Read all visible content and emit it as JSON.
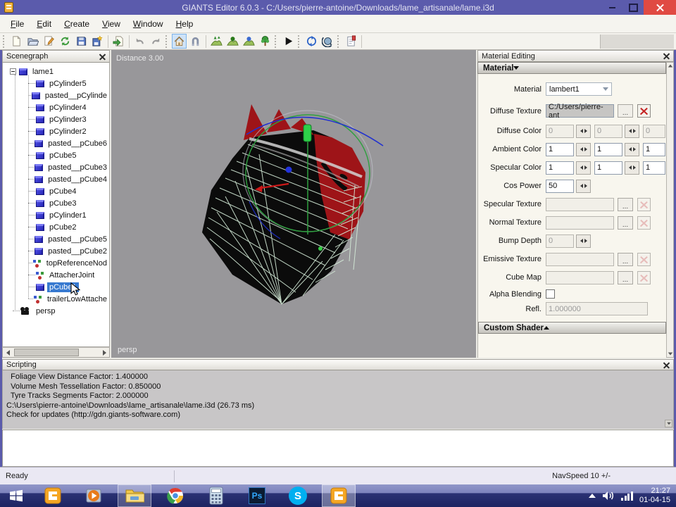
{
  "window": {
    "title": "GIANTS Editor 6.0.3 - C:/Users/pierre-antoine/Downloads/lame_artisanale/lame.i3d"
  },
  "menu": {
    "items": [
      {
        "label": "File"
      },
      {
        "label": "Edit"
      },
      {
        "label": "Create"
      },
      {
        "label": "View"
      },
      {
        "label": "Window"
      },
      {
        "label": "Help"
      }
    ]
  },
  "toolbar": {
    "icons": [
      "new-file",
      "open-file",
      "edit-script",
      "reload",
      "save",
      "export",
      "import",
      "undo",
      "redo",
      "move-home",
      "snap-magnet",
      "terrain-sculpt",
      "terrain-smooth",
      "terrain-paint",
      "foliage-paint",
      "play",
      "reload-shaders",
      "visualization",
      "show-log"
    ]
  },
  "scenegraph": {
    "title": "Scenegraph",
    "nodes": [
      {
        "label": "lame1",
        "type": "cube",
        "depth": 0,
        "expanded": true,
        "selected": false
      },
      {
        "label": "pCylinder5",
        "type": "cube",
        "depth": 1,
        "selected": false
      },
      {
        "label": "pasted__pCylinde",
        "type": "cube",
        "depth": 1,
        "selected": false
      },
      {
        "label": "pCylinder4",
        "type": "cube",
        "depth": 1,
        "selected": false
      },
      {
        "label": "pCylinder3",
        "type": "cube",
        "depth": 1,
        "selected": false
      },
      {
        "label": "pCylinder2",
        "type": "cube",
        "depth": 1,
        "selected": false
      },
      {
        "label": "pasted__pCube6",
        "type": "cube",
        "depth": 1,
        "selected": false
      },
      {
        "label": "pCube5",
        "type": "cube",
        "depth": 1,
        "selected": false
      },
      {
        "label": "pasted__pCube3",
        "type": "cube",
        "depth": 1,
        "selected": false
      },
      {
        "label": "pasted__pCube4",
        "type": "cube",
        "depth": 1,
        "selected": false
      },
      {
        "label": "pCube4",
        "type": "cube",
        "depth": 1,
        "selected": false
      },
      {
        "label": "pCube3",
        "type": "cube",
        "depth": 1,
        "selected": false
      },
      {
        "label": "pCylinder1",
        "type": "cube",
        "depth": 1,
        "selected": false
      },
      {
        "label": "pCube2",
        "type": "cube",
        "depth": 1,
        "selected": false
      },
      {
        "label": "pasted__pCube5",
        "type": "cube",
        "depth": 1,
        "selected": false
      },
      {
        "label": "pasted__pCube2",
        "type": "cube",
        "depth": 1,
        "selected": false
      },
      {
        "label": "topReferenceNod",
        "type": "group",
        "depth": 1,
        "selected": false
      },
      {
        "label": "AttacherJoint",
        "type": "group",
        "depth": 1,
        "selected": false
      },
      {
        "label": "pCube1",
        "type": "cube",
        "depth": 1,
        "selected": true
      },
      {
        "label": "trailerLowAttache",
        "type": "group",
        "depth": 1,
        "selected": false
      },
      {
        "label": "persp",
        "type": "camera",
        "depth": 0,
        "selected": false
      }
    ]
  },
  "viewport": {
    "distance_label": "Distance 3.00",
    "camera_label": "persp"
  },
  "material": {
    "panel_title": "Material Editing",
    "section_title": "Material",
    "material_label": "Material",
    "material_value": "lambert1",
    "diffuse_texture_label": "Diffuse Texture",
    "diffuse_texture_value": "C:/Users/pierre-ant",
    "browse_label": "...",
    "diffuse_color_label": "Diffuse Color",
    "diffuse_color": [
      "0",
      "0",
      "0"
    ],
    "ambient_color_label": "Ambient Color",
    "ambient_color": [
      "1",
      "1",
      "1"
    ],
    "specular_color_label": "Specular Color",
    "specular_color": [
      "1",
      "1",
      "1"
    ],
    "cos_power_label": "Cos Power",
    "cos_power_value": "50",
    "specular_texture_label": "Specular Texture",
    "normal_texture_label": "Normal Texture",
    "bump_depth_label": "Bump Depth",
    "bump_depth_value": "0",
    "emissive_texture_label": "Emissive Texture",
    "cube_map_label": "Cube Map",
    "alpha_blending_label": "Alpha Blending",
    "refl_label": "Refl.",
    "refl_value": "1.000000",
    "custom_shader_title": "Custom Shader"
  },
  "scripting": {
    "title": "Scripting",
    "lines": [
      "  Foliage View Distance Factor: 1.400000",
      "  Volume Mesh Tessellation Factor: 0.850000",
      "  Tyre Tracks Segments Factor: 2.000000",
      "C:\\Users\\pierre-antoine\\Downloads\\lame_artisanale\\lame.i3d (26.73 ms)",
      "Check for updates (http://gdn.giants-software.com)"
    ]
  },
  "statusbar": {
    "ready": "Ready",
    "navspeed": "NavSpeed 10 +/-"
  },
  "taskbar": {
    "apps": [
      "start",
      "giants-editor",
      "media-player",
      "file-explorer",
      "chrome",
      "calculator",
      "photoshop",
      "skype",
      "giants-editor-active"
    ],
    "photoshop_label": "Ps",
    "skype_label": "S",
    "clock_time": "21:27",
    "clock_date": "01-04-15"
  },
  "colors": {
    "titlebar": "#5b5bac",
    "close_button": "#e04a43",
    "selection": "#3779d0",
    "viewport_bg": "#98979a",
    "taskbar_dark": "#1d2462",
    "panel_cream": "#f8f6ee"
  }
}
